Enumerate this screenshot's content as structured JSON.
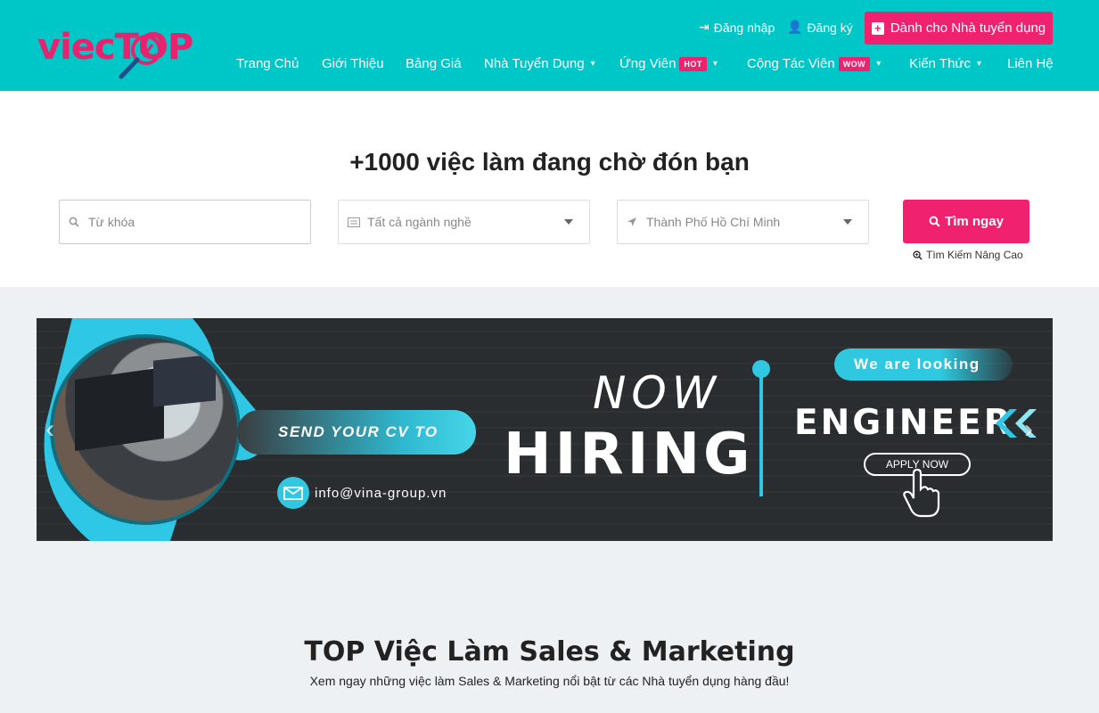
{
  "brand": {
    "logo_text_a": "viec",
    "logo_text_b": "TOP",
    "primary_color": "#00c7c7",
    "accent_color": "#f0226f"
  },
  "header": {
    "login_label": "Đăng nhập",
    "register_label": "Đăng ký",
    "employer_label": "Dành cho Nhà tuyển dụng",
    "nav": [
      {
        "label": "Trang Chủ"
      },
      {
        "label": "Giới Thiệu"
      },
      {
        "label": "Bảng Giá"
      },
      {
        "label": "Nhà Tuyển Dụng"
      },
      {
        "label": "Ứng Viên",
        "badge": "HOT"
      },
      {
        "label": "Cộng Tác Viên",
        "badge": "WOW"
      },
      {
        "label": "Kiến Thức"
      },
      {
        "label": "Liên Hệ"
      }
    ]
  },
  "search": {
    "headline": "+1000 việc làm đang chờ đón bạn",
    "keyword_placeholder": "Từ khóa",
    "industry_value": "Tất cả ngành nghề",
    "location_value": "Thành Phố Hồ Chí Minh",
    "search_button": "Tìm ngay",
    "advanced_link": "Tìm Kiếm Nâng Cao"
  },
  "banner": {
    "send_cv": "SEND YOUR CV TO",
    "email": "info@vina-group.vn",
    "now": "NOW",
    "hiring": "HIRING",
    "looking": "We are looking",
    "engineer": "ENGINEER",
    "apply": "APPLY NOW"
  },
  "section": {
    "title": "TOP Việc Làm Sales & Marketing",
    "subtitle": "Xem ngay những việc làm Sales & Marketing nổi bật từ các Nhà tuyển dụng hàng đầu!"
  }
}
